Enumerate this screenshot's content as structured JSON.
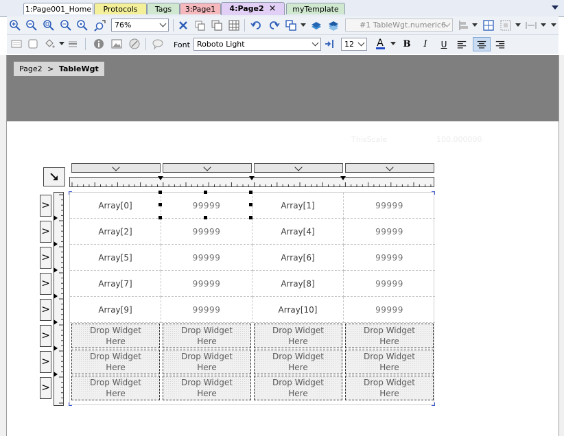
{
  "tabs": [
    {
      "label": "1:Page001_Home",
      "color": "#ffffff",
      "active": false
    },
    {
      "label": "Protocols",
      "color": "#f4f09a",
      "active": false
    },
    {
      "label": "Tags",
      "color": "#cfe8cf",
      "active": false
    },
    {
      "label": "3:Page1",
      "color": "#f5b8bd",
      "active": false
    },
    {
      "label": "4:Page2",
      "color": "#e2cff5",
      "active": true,
      "closable": true
    },
    {
      "label": "myTemplate",
      "color": "#cfe8cf",
      "active": false
    }
  ],
  "tab_close_glyph": "×",
  "toolbar": {
    "zoom_value": "76%",
    "widget_selector": "#1 TableWgt.numeric6",
    "font_label": "Font",
    "font_value": "Roboto Light",
    "font_size": "12",
    "bold_label": "B",
    "italic_label": "I",
    "underline_label": "U",
    "font_color": "#1f49c7",
    "icons_row1": [
      "zoom-in-icon",
      "zoom-out-icon",
      "zoom-page-icon",
      "zoom-fit-icon",
      "zoom-selection-icon",
      "zoom-tool-icon",
      "delete-icon",
      "copy-icon",
      "duplicate-icon",
      "grid-icon",
      "rotate-left-icon",
      "rotate-right-icon",
      "group-icon",
      "bring-front-icon",
      "send-back-icon",
      "align-left-icon",
      "center-icon",
      "distribute-icon",
      "spacing-icon"
    ],
    "icons_row2": [
      "screen-icon",
      "frame-icon",
      "paint-bucket-icon",
      "line-style-icon",
      "info-icon",
      "image-icon",
      "eraser-icon",
      "comment-icon",
      "tag-link-icon",
      "align-text-left-icon",
      "align-text-center-icon",
      "align-text-right-icon"
    ]
  },
  "breadcrumb": {
    "parent": "Page2",
    "separator": ">",
    "current": "TableWgt"
  },
  "faint_labels": [
    "ThisScale",
    "100.000000"
  ],
  "table": {
    "corner_button_icon": "arrow-down-right-icon",
    "column_header_icon": "chevron-down-icon",
    "row_button_glyph": ">",
    "rows": [
      [
        "Array[0]",
        "99999",
        "Array[1]",
        "99999"
      ],
      [
        "Array[2]",
        "99999",
        "Array[4]",
        "99999"
      ],
      [
        "Array[5]",
        "99999",
        "Array[6]",
        "99999"
      ],
      [
        "Array[7]",
        "99999",
        "Array[8]",
        "99999"
      ],
      [
        "Array[9]",
        "99999",
        "Array[10]",
        "99999"
      ]
    ],
    "drop_rows": 3,
    "drop_text": "Drop Widget\nHere",
    "selection_color": "#3b5bd6"
  }
}
